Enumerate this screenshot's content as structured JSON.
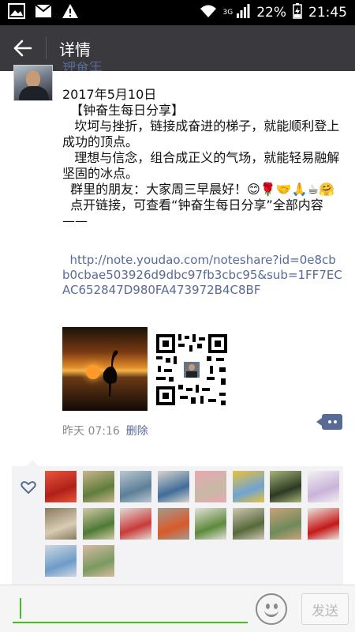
{
  "status_bar": {
    "network": "3G",
    "battery": "22%",
    "time": "21:45"
  },
  "header": {
    "title": "详情",
    "back_icon": "arrow-left-icon"
  },
  "post": {
    "author": "钟奋生",
    "body": "2017年5月10日\n  【钟奋生每日分享】\n   坎坷与挫折，链接成奋进的梯子，就能顺利登上成功的顶点。\n   理想与信念，组合成正义的气场，就能轻易融解坚固的冰点。\n  群里的朋友：大家周三早晨好！😊🌹🤝🙏☕🤗\n  点开链接，可查看“钟奋生每日分享”全部内容——",
    "link": "  http://note.youdao.com/noteshare?id=0e8cbb0cbae503926d9dbc97fb3cbc95&sub=1FF7ECAC652847D980FA473972B4C8BF",
    "images": [
      "sunset-heron-photo",
      "qr-code-image"
    ],
    "time": "昨天 07:16",
    "delete_label": "删除"
  },
  "likes": {
    "icon": "heart-outline-icon",
    "likers": [
      {
        "c1": "#b0201a",
        "c2": "#e8553a"
      },
      {
        "c1": "#5f7d3c",
        "c2": "#c9b58d"
      },
      {
        "c1": "#5d7f98",
        "c2": "#b8c7cf"
      },
      {
        "c1": "#3f6d9a",
        "c2": "#d9d4cc"
      },
      {
        "c1": "#c7b9a5",
        "c2": "#e9a7b2"
      },
      {
        "c1": "#6fa3d4",
        "c2": "#e8c23b"
      },
      {
        "c1": "#2c3a24",
        "c2": "#a8b478"
      },
      {
        "c1": "#c9b3d8",
        "c2": "#f3f0f2"
      },
      {
        "c1": "#d7cdb5",
        "c2": "#8a7a5c"
      },
      {
        "c1": "#4e7a35",
        "c2": "#d2c9a8"
      },
      {
        "c1": "#c93a3a",
        "c2": "#e0dcd5"
      },
      {
        "c1": "#d85a2a",
        "c2": "#a39b8f"
      },
      {
        "c1": "#5d8a3c",
        "c2": "#e3e1d8"
      },
      {
        "c1": "#57693a",
        "c2": "#cfc7b4"
      },
      {
        "c1": "#6f8a5a",
        "c2": "#c9a37a"
      },
      {
        "c1": "#c41818",
        "c2": "#ebe5df"
      },
      {
        "c1": "#6d9bc9",
        "c2": "#cfd8df"
      },
      {
        "c1": "#7a9a60",
        "c2": "#d7b9a3"
      }
    ]
  },
  "input_bar": {
    "placeholder": "",
    "emoji_icon": "smiley-face-icon",
    "send_label": "发送"
  }
}
